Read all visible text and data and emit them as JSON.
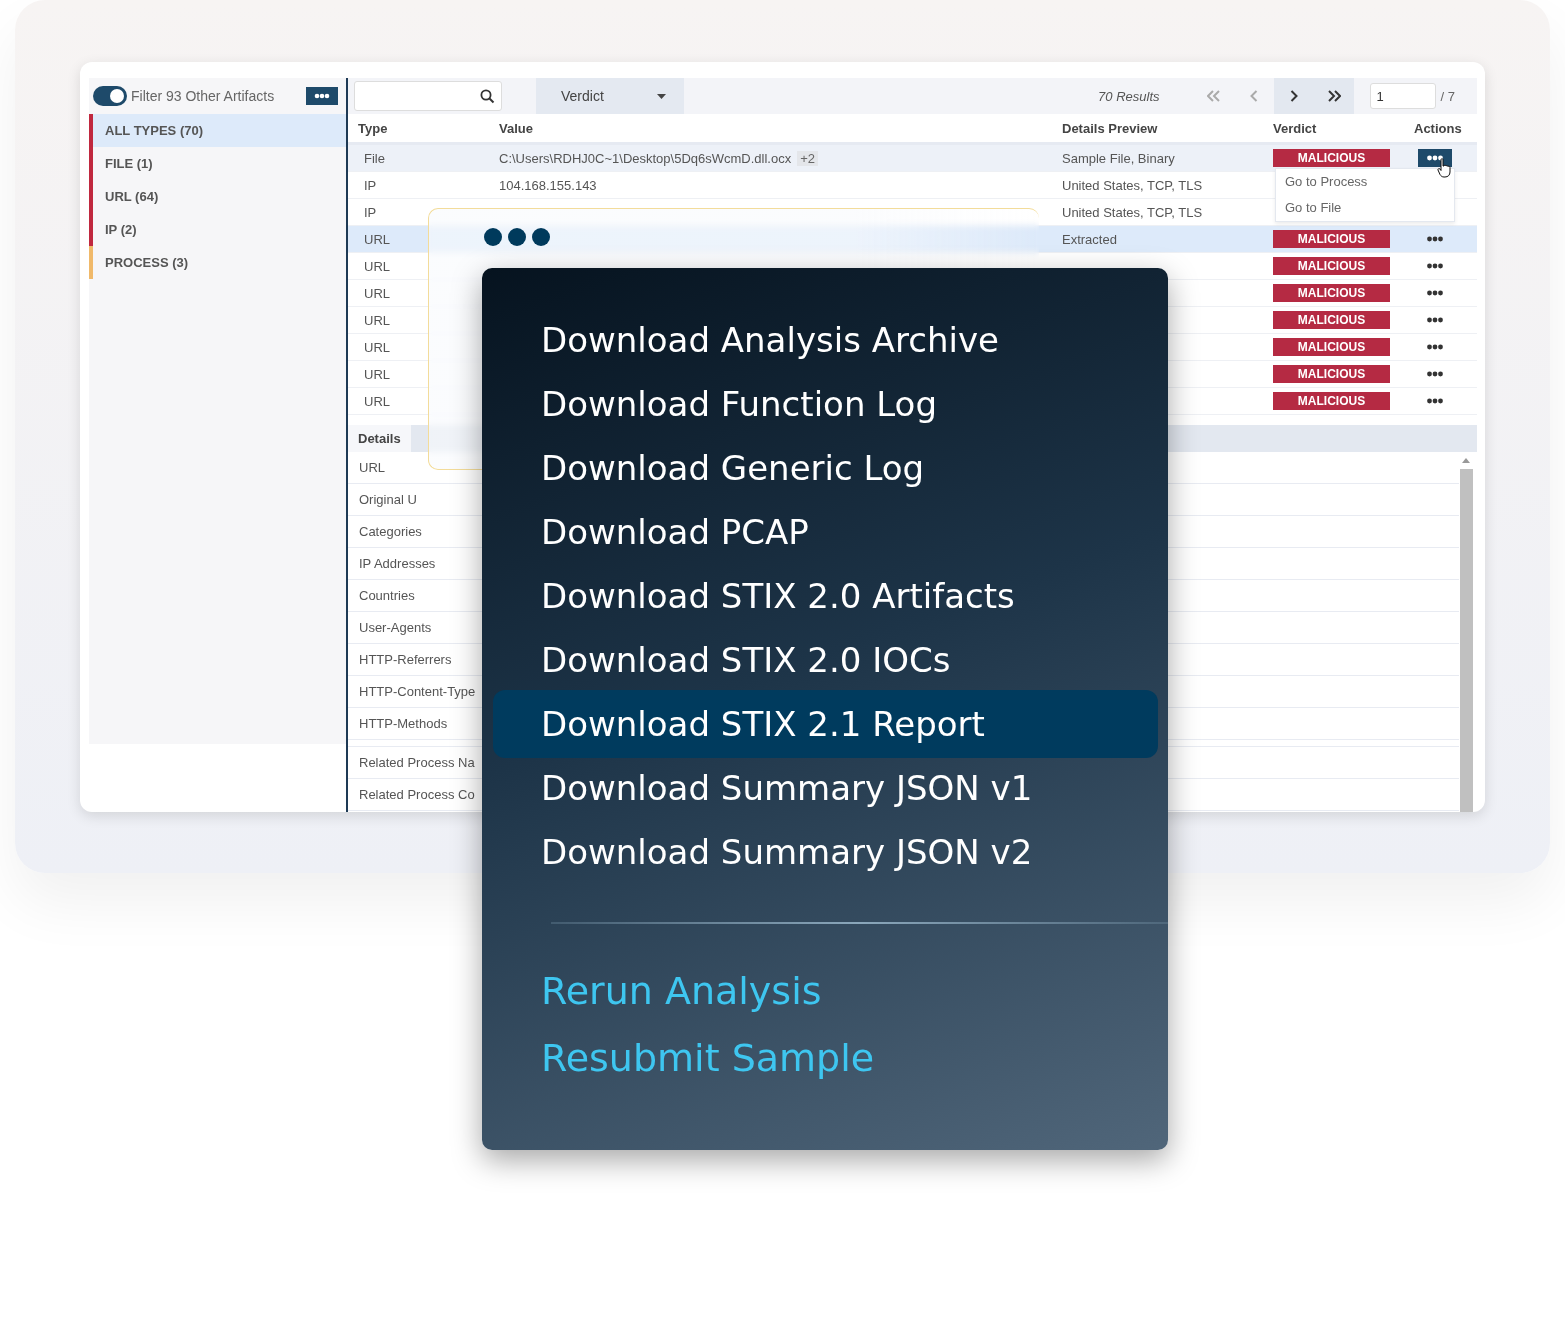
{
  "sidebar": {
    "filter_toggle": {
      "label": "Filter 93 Other Artifacts",
      "on": true
    },
    "items": [
      {
        "label": "ALL TYPES (70)",
        "selected": true,
        "color": "#c0283f"
      },
      {
        "label": "FILE (1)",
        "selected": false,
        "color": "#c0283f"
      },
      {
        "label": "URL (64)",
        "selected": false,
        "color": "#c0283f"
      },
      {
        "label": "IP (2)",
        "selected": false,
        "color": "#c0283f"
      },
      {
        "label": "PROCESS (3)",
        "selected": false,
        "color": "#f0b96a"
      }
    ]
  },
  "toolbar": {
    "verdict_filter": "Verdict",
    "results": "70 Results",
    "pager": [
      {
        "kind": "first",
        "disabled": true
      },
      {
        "kind": "prev",
        "disabled": true
      },
      {
        "kind": "next",
        "disabled": false
      },
      {
        "kind": "last",
        "disabled": false
      }
    ],
    "page": "1",
    "page_total": "/ 7"
  },
  "table": {
    "columns": [
      "Type",
      "Value",
      "Details Preview",
      "Verdict",
      "Actions"
    ],
    "rows": [
      {
        "type": "File",
        "value": "C:\\Users\\RDHJ0C~1\\Desktop\\5Dq6sWcmD.dll.ocx",
        "value_badge": "+2",
        "details": "Sample File, Binary",
        "verdict": "MALICIOUS",
        "action": {
          "open": true
        },
        "selected": false,
        "hovered": true
      },
      {
        "type": "IP",
        "value": "104.168.155.143",
        "details": "United States, TCP, TLS",
        "selected": false,
        "hovered": false
      },
      {
        "type": "IP",
        "details": "United States, TCP, TLS",
        "selected": false,
        "hovered": false
      },
      {
        "type": "URL",
        "details": "Extracted",
        "verdict": "MALICIOUS",
        "action": {
          "open": false
        },
        "selected": true,
        "hovered": false
      },
      {
        "type": "URL",
        "verdict": "MALICIOUS",
        "action": {
          "open": false
        },
        "selected": false,
        "hovered": false
      },
      {
        "type": "URL",
        "verdict": "MALICIOUS",
        "action": {
          "open": false
        },
        "selected": false,
        "hovered": false
      },
      {
        "type": "URL",
        "verdict": "MALICIOUS",
        "action": {
          "open": false
        },
        "selected": false,
        "hovered": false
      },
      {
        "type": "URL",
        "verdict": "MALICIOUS",
        "action": {
          "open": false
        },
        "selected": false,
        "hovered": false
      },
      {
        "type": "URL",
        "verdict": "MALICIOUS",
        "action": {
          "open": false
        },
        "selected": false,
        "hovered": false
      },
      {
        "type": "URL",
        "verdict": "MALICIOUS",
        "action": {
          "open": false
        },
        "selected": false,
        "hovered": false
      }
    ]
  },
  "row_menu": [
    "Go to Process",
    "Go to File"
  ],
  "details": {
    "tabs": [
      {
        "label": "Details",
        "selected": true
      }
    ],
    "fields": [
      "URL",
      "Original U",
      "Categories",
      "IP Addresses",
      "Countries",
      "User-Agents",
      "HTTP-Referrers",
      "HTTP-Content-Type",
      "HTTP-Methods"
    ],
    "related_fields": [
      "Related Process Na",
      "Related Process Co"
    ]
  },
  "action_menu": {
    "items": [
      {
        "label": "Download Analysis Archive",
        "kind": "download",
        "selected": false
      },
      {
        "label": "Download Function Log",
        "kind": "download",
        "selected": false
      },
      {
        "label": "Download Generic Log",
        "kind": "download",
        "selected": false
      },
      {
        "label": "Download PCAP",
        "kind": "download",
        "selected": false
      },
      {
        "label": "Download STIX 2.0 Artifacts",
        "kind": "download",
        "selected": false
      },
      {
        "label": "Download STIX 2.0 IOCs",
        "kind": "download",
        "selected": false
      },
      {
        "label": "Download STIX 2.1 Report",
        "kind": "download",
        "selected": true
      },
      {
        "label": "Download Summary JSON v1",
        "kind": "download",
        "selected": false
      },
      {
        "label": "Download Summary JSON v2",
        "kind": "download",
        "selected": false
      },
      {
        "kind": "divider"
      },
      {
        "label": "Rerun Analysis",
        "kind": "action",
        "selected": false
      },
      {
        "label": "Resubmit Sample",
        "kind": "action",
        "selected": false
      }
    ]
  }
}
